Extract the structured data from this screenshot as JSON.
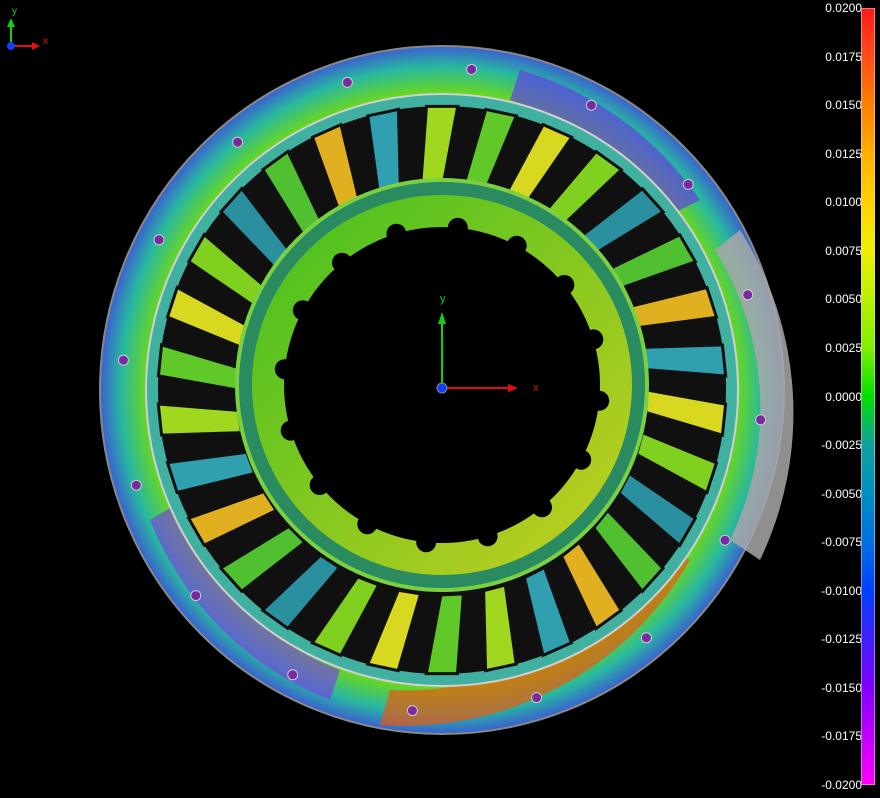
{
  "viewport": {
    "corner_triad": {
      "x_label": "x",
      "y_label": "y"
    },
    "center_triad": {
      "x_label": "x",
      "y_label": "y"
    }
  },
  "color_scale": {
    "labels": [
      "0.0200",
      "0.0175",
      "0.0150",
      "0.0125",
      "0.0100",
      "0.0075",
      "0.0050",
      "0.0025",
      "0.0000",
      "-0.0025",
      "-0.0050",
      "-0.0075",
      "-0.0100",
      "-0.0125",
      "-0.0150",
      "-0.0175",
      "-0.0200"
    ],
    "stops": [
      "#ff1a1a",
      "#ff4d1a",
      "#ff8000",
      "#ffb000",
      "#ffd200",
      "#f0f000",
      "#b8f000",
      "#80f000",
      "#00e000",
      "#10a0a0",
      "#0090c0",
      "#0070e0",
      "#0040ff",
      "#4020ff",
      "#8000ff",
      "#c000ff",
      "#ff00ff"
    ]
  }
}
